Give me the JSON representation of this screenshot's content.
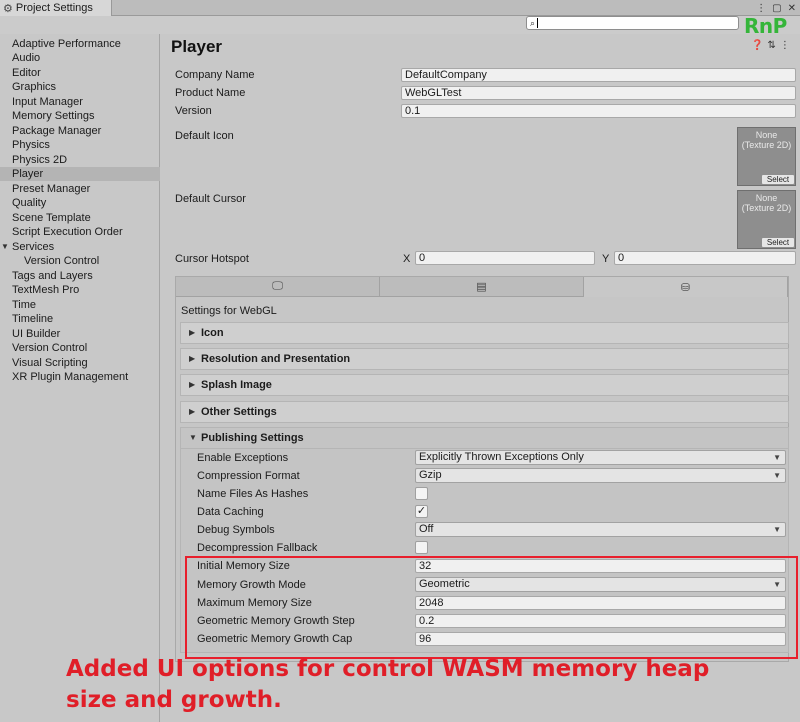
{
  "window": {
    "tab_title": "Project Settings",
    "tab_icon": "gear-icon",
    "controls": [
      "⋮",
      "▢",
      "✕"
    ]
  },
  "search": {
    "placeholder": "",
    "icon": "search-icon"
  },
  "brand_logo": "RnP",
  "sidebar": {
    "items": [
      {
        "label": "Adaptive Performance"
      },
      {
        "label": "Audio"
      },
      {
        "label": "Editor"
      },
      {
        "label": "Graphics"
      },
      {
        "label": "Input Manager"
      },
      {
        "label": "Memory Settings"
      },
      {
        "label": "Package Manager"
      },
      {
        "label": "Physics"
      },
      {
        "label": "Physics 2D"
      },
      {
        "label": "Player",
        "selected": true
      },
      {
        "label": "Preset Manager"
      },
      {
        "label": "Quality"
      },
      {
        "label": "Scene Template"
      },
      {
        "label": "Script Execution Order"
      },
      {
        "label": "Services",
        "expanded": true
      },
      {
        "label": "Version Control",
        "child": true
      },
      {
        "label": "Tags and Layers"
      },
      {
        "label": "TextMesh Pro"
      },
      {
        "label": "Time"
      },
      {
        "label": "Timeline"
      },
      {
        "label": "UI Builder"
      },
      {
        "label": "Version Control"
      },
      {
        "label": "Visual Scripting"
      },
      {
        "label": "XR Plugin Management"
      }
    ]
  },
  "player": {
    "title": "Player",
    "header_icons": [
      "help-icon",
      "preset-icon",
      "menu-icon"
    ],
    "company_name": {
      "label": "Company Name",
      "value": "DefaultCompany"
    },
    "product_name": {
      "label": "Product Name",
      "value": "WebGLTest"
    },
    "version": {
      "label": "Version",
      "value": "0.1"
    },
    "default_icon": {
      "label": "Default Icon",
      "slot_text": "None\n(Texture 2D)",
      "select": "Select"
    },
    "default_cursor": {
      "label": "Default Cursor",
      "slot_text": "None\n(Texture 2D)",
      "select": "Select"
    },
    "cursor_hotspot": {
      "label": "Cursor Hotspot",
      "x_label": "X",
      "x_value": "0",
      "y_label": "Y",
      "y_value": "0"
    }
  },
  "platform_tabs": [
    {
      "icon": "monitor-icon",
      "glyph": "🖵",
      "active": false
    },
    {
      "icon": "server-icon",
      "glyph": "▤",
      "active": false
    },
    {
      "icon": "webgl-icon",
      "glyph": "⛁",
      "active": true
    }
  ],
  "settings_for": "Settings for WebGL",
  "sections": {
    "icon": "Icon",
    "resolution": "Resolution and Presentation",
    "splash": "Splash Image",
    "other": "Other Settings",
    "publishing": "Publishing Settings"
  },
  "publishing": {
    "enable_exceptions": {
      "label": "Enable Exceptions",
      "value": "Explicitly Thrown Exceptions Only"
    },
    "compression_format": {
      "label": "Compression Format",
      "value": "Gzip"
    },
    "name_files_as_hashes": {
      "label": "Name Files As Hashes",
      "checked": false
    },
    "data_caching": {
      "label": "Data Caching",
      "checked": true
    },
    "debug_symbols": {
      "label": "Debug Symbols",
      "value": "Off"
    },
    "decompression_fallback": {
      "label": "Decompression Fallback",
      "checked": false
    },
    "initial_memory_size": {
      "label": "Initial Memory Size",
      "value": "32"
    },
    "memory_growth_mode": {
      "label": "Memory Growth Mode",
      "value": "Geometric"
    },
    "maximum_memory_size": {
      "label": "Maximum Memory Size",
      "value": "2048"
    },
    "geometric_growth_step": {
      "label": "Geometric Memory Growth Step",
      "value": "0.2"
    },
    "geometric_growth_cap": {
      "label": "Geometric Memory Growth Cap",
      "value": "96"
    }
  },
  "annotation": {
    "text": "Added UI options for control WASM memory heap size and growth.",
    "color": "#e01e28",
    "box_color": "#e81f2c"
  },
  "checkmark": "✓"
}
